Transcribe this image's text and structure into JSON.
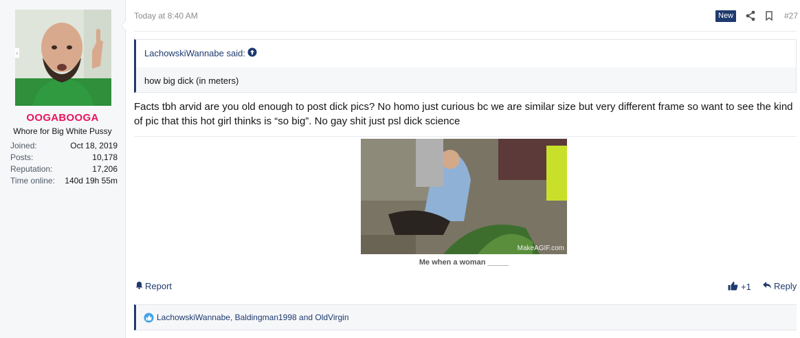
{
  "user": {
    "username": "OOGABOOGA",
    "title": "Whore for Big White Pussy",
    "stats": [
      {
        "label": "Joined:",
        "value": "Oct 18, 2019"
      },
      {
        "label": "Posts:",
        "value": "10,178"
      },
      {
        "label": "Reputation:",
        "value": "17,206"
      },
      {
        "label": "Time online:",
        "value": "140d 19h 55m"
      }
    ]
  },
  "post": {
    "time": "Today at 8:40 AM",
    "badge": "New",
    "number": "#27",
    "quote": {
      "author": "LachowskiWannabe said:",
      "text": "how big dick (in meters)"
    },
    "message": "Facts tbh arvid are you old enough to post dick pics? No homo just curious bc we are similar size but very different frame so want to see the kind of pic that this hot girl thinks is “so big”. No gay shit just psl dick science",
    "gif": {
      "watermark": "MakeAGIF.com",
      "caption": "Me when a woman _____"
    },
    "actions": {
      "report": "Report",
      "like_count": "+1",
      "reply": "Reply"
    },
    "reactions": "LachowskiWannabe, Baldingman1998 and OldVirgin"
  },
  "colors": {
    "accent": "#1e3a6e",
    "username": "#e8145a",
    "sidebar_bg": "#f6f7f9"
  },
  "icons": [
    "share-icon",
    "bookmark-icon",
    "arrow-up-circle-icon",
    "bell-icon",
    "thumbs-up-icon",
    "reply-arrow-icon",
    "like-reaction-icon"
  ]
}
